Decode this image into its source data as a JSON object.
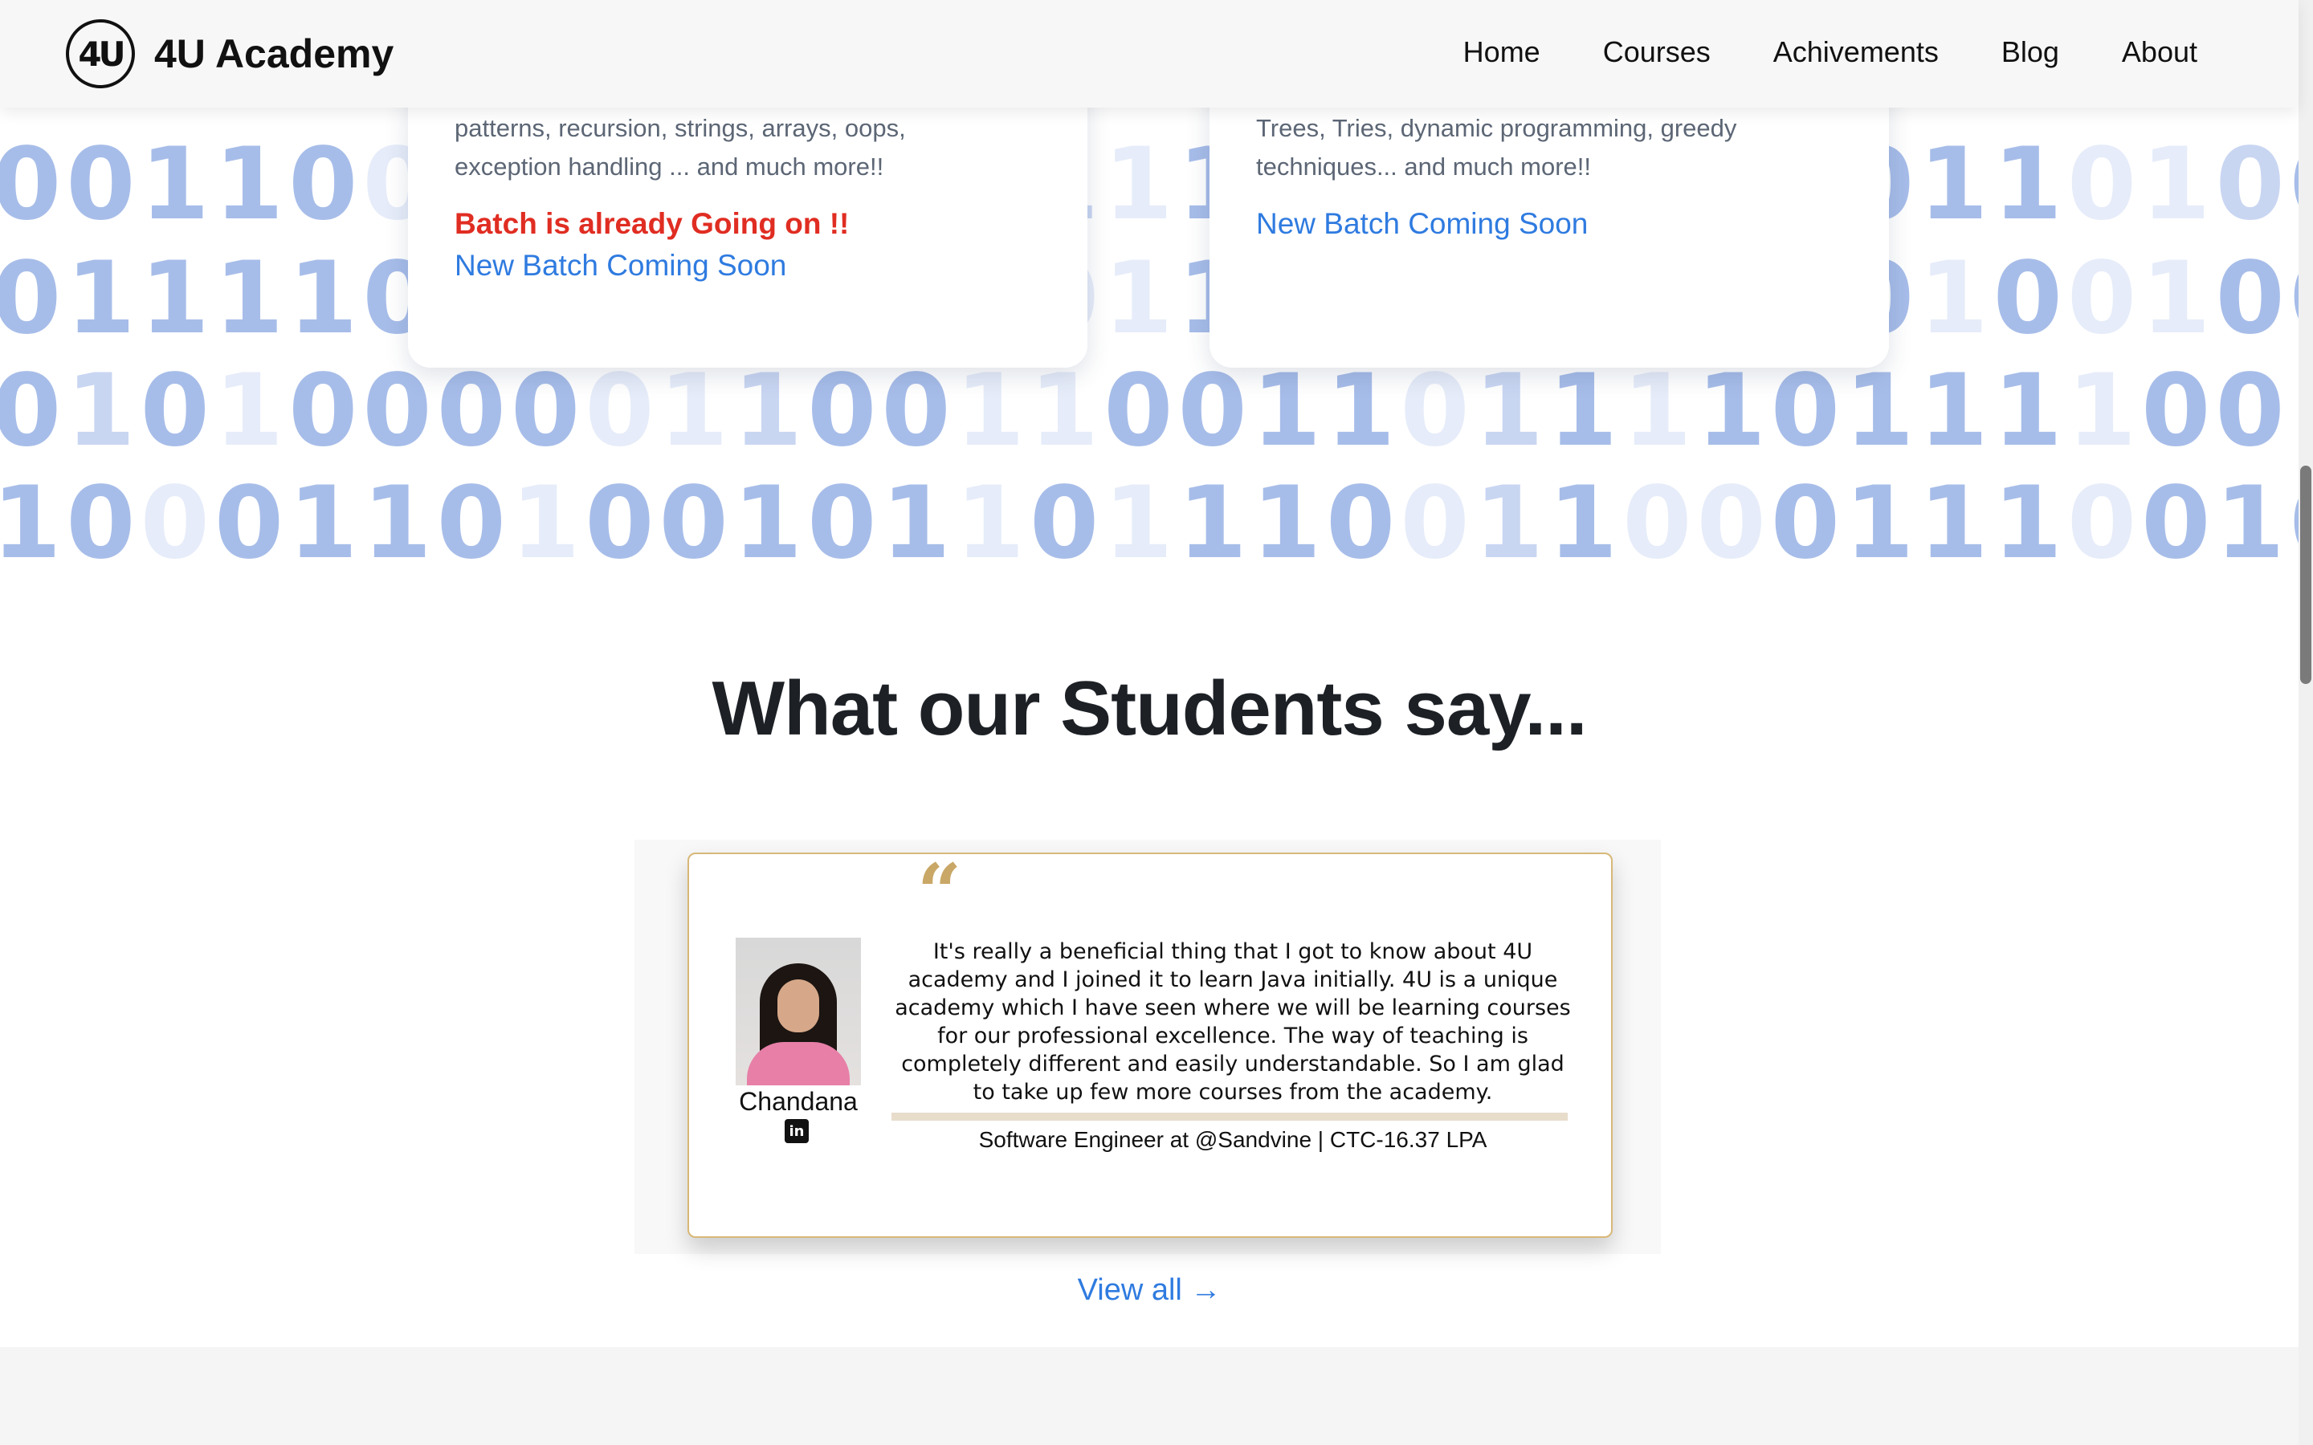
{
  "brand": {
    "logo_text": "4U",
    "name": "4U Academy"
  },
  "nav": [
    "Home",
    "Courses",
    "Achivements",
    "Blog",
    "About"
  ],
  "cards": [
    {
      "description_line1": "patterns, recursion, strings, arrays, oops,",
      "description_line2": "exception handling ... and much more!!",
      "status_going": "Batch is already Going on !!",
      "status_soon": "New Batch Coming Soon"
    },
    {
      "description_line1": "Trees, Tries, dynamic programming, greedy",
      "description_line2": "techniques... and much more!!",
      "status_soon": "New Batch Coming Soon"
    }
  ],
  "testimonials": {
    "title": "What our Students say...",
    "quote_mark": "“",
    "person": {
      "name": "Chandana",
      "linkedin_icon": "in",
      "quote": "It's really a beneficial thing that I got to know about 4U academy and I joined it to learn Java initially. 4U is a unique academy which I have seen where we will be learning courses for our professional excellence. The way of teaching is completely different and easily understandable. So I am glad to take up few more courses from the academy.",
      "role": "Software Engineer at @Sandvine | CTC-16.37 LPA"
    },
    "view_all": "View all →"
  },
  "colors": {
    "accent_blue": "#2f7be0",
    "alert_red": "#e02d22",
    "card_border_gold": "#d8b878",
    "quote_gold": "#c9a766"
  },
  "icons": [
    "logo-icon",
    "quote-icon",
    "linkedin-icon",
    "arrow-right-icon"
  ]
}
